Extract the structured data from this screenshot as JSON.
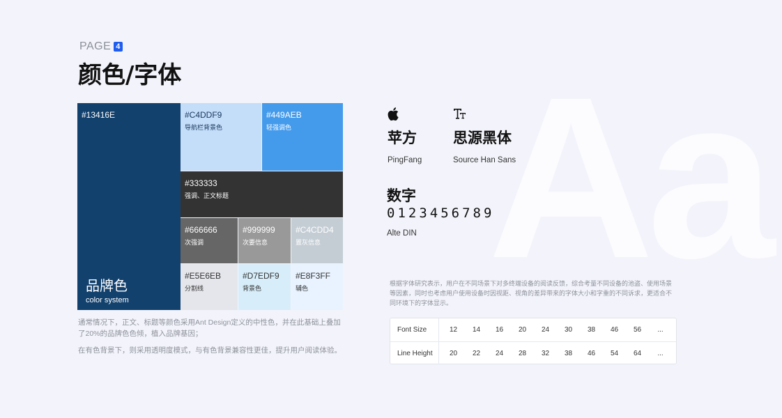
{
  "page": {
    "label": "PAGE",
    "number": "4",
    "title": "颜色/字体"
  },
  "background_letters": "Aa",
  "palette": {
    "brand": {
      "hex": "#13416E",
      "name": "品牌色",
      "sub": "color system",
      "color": "#13416E"
    },
    "swatches": [
      {
        "id": "c4ddf9",
        "hex": "#C4DDF9",
        "desc": "导航栏背景色",
        "color": "#C4DDF9",
        "text": "#1a3a60"
      },
      {
        "id": "449aeb",
        "hex": "#449AEB",
        "desc": "轻强调色",
        "color": "#449AEB",
        "text": "#ffffff"
      },
      {
        "id": "333333",
        "hex": "#333333",
        "desc": "强调、正文标题",
        "color": "#333333",
        "text": "#ffffff"
      },
      {
        "id": "666666",
        "hex": "#666666",
        "desc": "次强调",
        "color": "#666666",
        "text": "#ffffff"
      },
      {
        "id": "999999",
        "hex": "#999999",
        "desc": "次要信息",
        "color": "#999999",
        "text": "#ffffff"
      },
      {
        "id": "c4cdd4",
        "hex": "#C4CDD4",
        "desc": "置灰信息",
        "color": "#C4CDD4",
        "text": "#ffffff"
      },
      {
        "id": "e5e6eb",
        "hex": "#E5E6EB",
        "desc": "分割线",
        "color": "#E5E6EB",
        "text": "#333333"
      },
      {
        "id": "d7edf9",
        "hex": "#D7EDF9",
        "desc": "背景色",
        "color": "#D7EDF9",
        "text": "#333333"
      },
      {
        "id": "e8f3ff",
        "hex": "#E8F3FF",
        "desc": "辅色",
        "color": "#E8F3FF",
        "text": "#333333"
      }
    ]
  },
  "notes": {
    "line1": "通常情况下，正文、标题等颜色采用Ant Design定义的中性色，并在此基础上叠加了20%的品牌色色倾，植入品牌基因；",
    "line2": "在有色背景下，则采用透明度模式，与有色背景兼容性更佳，提升用户阅读体验。"
  },
  "fonts": {
    "pingfang": {
      "icon": "apple-icon",
      "name": "苹方",
      "en": "PingFang"
    },
    "sourcehan": {
      "icon": "text-size-icon",
      "name": "思源黑体",
      "en": "Source Han Sans"
    },
    "numbers": {
      "title": "数字",
      "digits": "0123456789",
      "en": "Alte DIN"
    }
  },
  "research_note": "根据字体研究表示，用户在不同场景下对多终端设备的阅读反馈，综合考量不同设备的池盗、使用场景等因素，同时也考虑用户使用设备时因视距、视角的差异带来的字体大小和字重的不同诉求，更适合不同环境下的字体显示。",
  "size_table": {
    "font_size": {
      "label": "Font Size",
      "values": [
        "12",
        "14",
        "16",
        "20",
        "24",
        "30",
        "38",
        "46",
        "56",
        "..."
      ]
    },
    "line_height": {
      "label": "Line Height",
      "values": [
        "20",
        "22",
        "24",
        "28",
        "32",
        "38",
        "46",
        "54",
        "64",
        "..."
      ]
    }
  }
}
